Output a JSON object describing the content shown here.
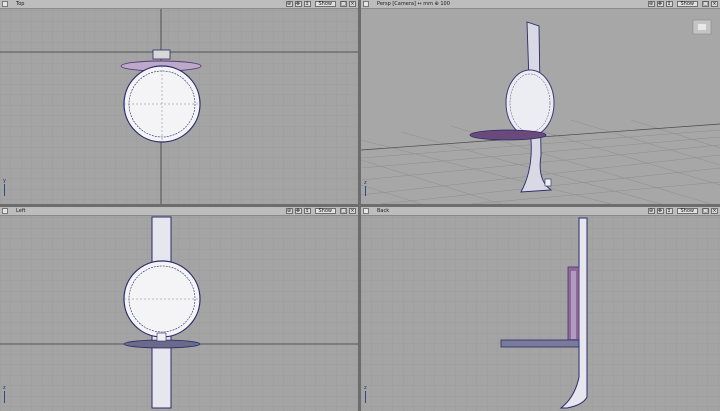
{
  "viewports": [
    {
      "id": "top",
      "label": "Top",
      "show_label": "Show"
    },
    {
      "id": "persp",
      "label": "Persp [Camera] ↔ mm  ⊕ 100",
      "show_label": "Show"
    },
    {
      "id": "left",
      "label": "Left",
      "show_label": "Show"
    },
    {
      "id": "back",
      "label": "Back",
      "show_label": "Show"
    }
  ],
  "axis_labels": {
    "x": "x",
    "y": "y",
    "z": "z"
  },
  "icons": [
    "viewport-corner-icon",
    "zoom-icon",
    "pan-icon",
    "maximize-icon",
    "close-icon"
  ],
  "colors": {
    "viewport_bg": "#a4a4a4",
    "grid": "#959595",
    "major_axis": "#3c3c3c",
    "model_outline": "#2a2a6a",
    "model_fill": "#c9c9d8",
    "selected": "#5b3a7a"
  }
}
